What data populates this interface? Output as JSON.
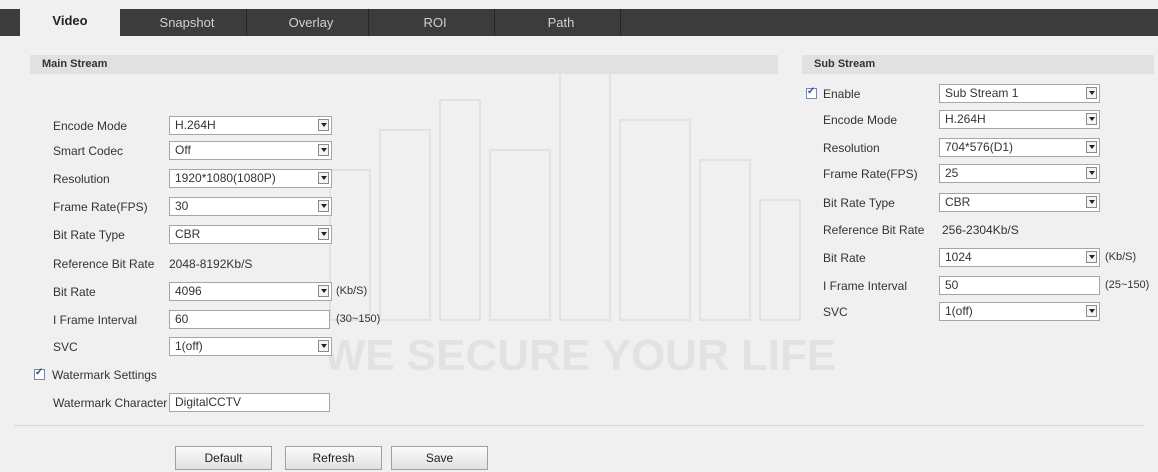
{
  "tabs": [
    {
      "label": "Video",
      "active": true
    },
    {
      "label": "Snapshot",
      "active": false
    },
    {
      "label": "Overlay",
      "active": false
    },
    {
      "label": "ROI",
      "active": false
    },
    {
      "label": "Path",
      "active": false
    }
  ],
  "main_stream": {
    "title": "Main Stream",
    "encode_mode": {
      "label": "Encode Mode",
      "value": "H.264H"
    },
    "smart_codec": {
      "label": "Smart Codec",
      "value": "Off"
    },
    "resolution": {
      "label": "Resolution",
      "value": "1920*1080(1080P)"
    },
    "frame_rate": {
      "label": "Frame Rate(FPS)",
      "value": "30"
    },
    "bit_rate_type": {
      "label": "Bit Rate Type",
      "value": "CBR"
    },
    "reference_bit_rate": {
      "label": "Reference Bit Rate",
      "value": "2048-8192Kb/S"
    },
    "bit_rate": {
      "label": "Bit Rate",
      "value": "4096",
      "unit": "(Kb/S)"
    },
    "i_frame_interval": {
      "label": "I Frame Interval",
      "value": "60",
      "range": "(30~150)"
    },
    "svc": {
      "label": "SVC",
      "value": "1(off)"
    },
    "watermark_settings": {
      "label": "Watermark Settings",
      "checked": true
    },
    "watermark_character": {
      "label": "Watermark Character",
      "value": "DigitalCCTV"
    }
  },
  "sub_stream": {
    "title": "Sub Stream",
    "enable": {
      "label": "Enable",
      "checked": true,
      "value": "Sub Stream 1"
    },
    "encode_mode": {
      "label": "Encode Mode",
      "value": "H.264H"
    },
    "resolution": {
      "label": "Resolution",
      "value": "704*576(D1)"
    },
    "frame_rate": {
      "label": "Frame Rate(FPS)",
      "value": "25"
    },
    "bit_rate_type": {
      "label": "Bit Rate Type",
      "value": "CBR"
    },
    "reference_bit_rate": {
      "label": "Reference Bit Rate",
      "value": "256-2304Kb/S"
    },
    "bit_rate": {
      "label": "Bit Rate",
      "value": "1024",
      "unit": "(Kb/S)"
    },
    "i_frame_interval": {
      "label": "I Frame Interval",
      "value": "50",
      "range": "(25~150)"
    },
    "svc": {
      "label": "SVC",
      "value": "1(off)"
    }
  },
  "buttons": {
    "default": "Default",
    "refresh": "Refresh",
    "save": "Save"
  },
  "watermark": {
    "slogan": "WE SECURE YOUR LIFE"
  },
  "colors": {
    "tab_bar": "#3c3c3c",
    "background": "#f0f0f0",
    "section_header": "#e1e1e1"
  }
}
